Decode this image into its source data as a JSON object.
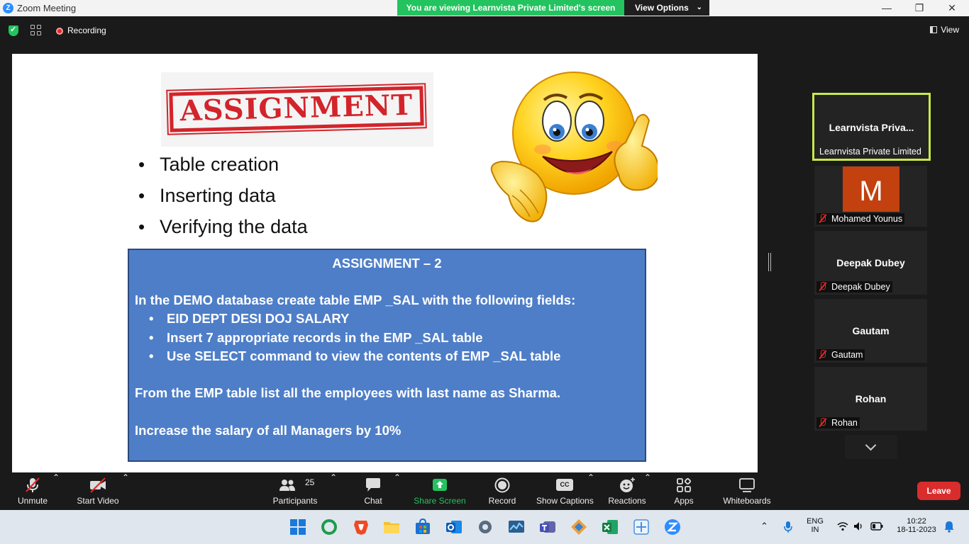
{
  "window": {
    "title": "Zoom Meeting",
    "share_banner": "You are viewing Learnvista Private Limited's screen",
    "view_options": "View Options",
    "minimize": "—",
    "restore": "❐",
    "close": "✕"
  },
  "topbar": {
    "recording_label": "Recording",
    "view_label": "View"
  },
  "slide": {
    "stamp_text": "ASSIGNMENT",
    "bullets": [
      "Table creation",
      "Inserting data",
      "Verifying the data"
    ],
    "box": {
      "title": "ASSIGNMENT – 2",
      "intro": "In the DEMO database  create table EMP _SAL with the following fields:",
      "items": [
        "EID DEPT DESI  DOJ SALARY",
        "Insert 7 appropriate records in the EMP _SAL table",
        "Use SELECT command to view the contents of EMP _SAL  table"
      ],
      "para2": "From the EMP table list  all the employees with last name as Sharma.",
      "para3": "Increase the salary of all Managers  by 10%"
    }
  },
  "participants": [
    {
      "display": "Learnvista  Priva...",
      "name": "Learnvista Private Limited",
      "muted": false,
      "active": true
    },
    {
      "display": "M",
      "name": "Mohamed Younus",
      "muted": true,
      "avatar_color": "#c2410f"
    },
    {
      "display": "Deepak Dubey",
      "name": "Deepak Dubey",
      "muted": true
    },
    {
      "display": "Gautam",
      "name": "Gautam",
      "muted": true
    },
    {
      "display": "Rohan",
      "name": "Rohan",
      "muted": true
    }
  ],
  "toolbar": {
    "unmute": "Unmute",
    "start_video": "Start Video",
    "participants": "Participants",
    "participants_count": "25",
    "chat": "Chat",
    "share_screen": "Share Screen",
    "record": "Record",
    "show_captions": "Show Captions",
    "cc": "CC",
    "reactions": "Reactions",
    "apps": "Apps",
    "whiteboards": "Whiteboards",
    "leave": "Leave"
  },
  "taskbar": {
    "lang_top": "ENG",
    "lang_bottom": "IN",
    "time": "10:22",
    "date": "18-11-2023"
  },
  "colors": {
    "share_green": "#23c35f",
    "leave_red": "#d92c2c",
    "active_border": "#c8e84a",
    "slide_box_blue": "#4e7ec8",
    "stamp_red": "#d2242a"
  }
}
